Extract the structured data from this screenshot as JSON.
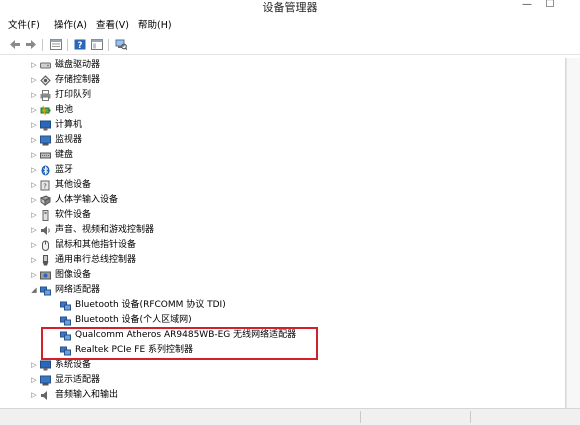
{
  "window": {
    "title": "设备管理器",
    "minimize_glyph": "—",
    "maximize_glyph": "☐"
  },
  "menu": [
    {
      "label": "文件(F)"
    },
    {
      "label": "操作(A)"
    },
    {
      "label": "查看(V)"
    },
    {
      "label": "帮助(H)"
    }
  ],
  "toolbar": {
    "buttons": [
      {
        "icon": "back-arrow-icon"
      },
      {
        "icon": "forward-arrow-icon"
      },
      {
        "icon": "properties-icon"
      },
      {
        "icon": "help-icon"
      },
      {
        "icon": "show-hide-console-tree-icon"
      },
      {
        "icon": "scan-hardware-icon"
      }
    ]
  },
  "tree": {
    "categories_before": [
      {
        "label": "磁盘驱动器",
        "icon": "disk-drive-icon",
        "expander": "▷"
      },
      {
        "label": "存储控制器",
        "icon": "storage-controller-icon",
        "expander": "▷"
      },
      {
        "label": "打印队列",
        "icon": "printer-icon",
        "expander": "▷"
      },
      {
        "label": "电池",
        "icon": "battery-icon",
        "expander": "▷"
      },
      {
        "label": "计算机",
        "icon": "computer-icon",
        "expander": "▷"
      },
      {
        "label": "监视器",
        "icon": "monitor-icon",
        "expander": "▷"
      },
      {
        "label": "键盘",
        "icon": "keyboard-icon",
        "expander": "▷"
      },
      {
        "label": "蓝牙",
        "icon": "bluetooth-icon",
        "expander": "▷"
      },
      {
        "label": "其他设备",
        "icon": "other-devices-icon",
        "expander": "▷"
      },
      {
        "label": "人体学输入设备",
        "icon": "hid-icon",
        "expander": "▷"
      },
      {
        "label": "软件设备",
        "icon": "software-device-icon",
        "expander": "▷"
      },
      {
        "label": "声音、视频和游戏控制器",
        "icon": "sound-icon",
        "expander": "▷"
      },
      {
        "label": "鼠标和其他指针设备",
        "icon": "mouse-icon",
        "expander": "▷"
      },
      {
        "label": "通用串行总线控制器",
        "icon": "usb-icon",
        "expander": "▷"
      },
      {
        "label": "图像设备",
        "icon": "imaging-device-icon",
        "expander": "▷"
      }
    ],
    "network_adapters": {
      "label": "网络适配器",
      "icon": "network-adapter-icon",
      "expander": "◢",
      "children": [
        {
          "label": "Bluetooth 设备(RFCOMM 协议 TDI)",
          "icon": "network-adapter-icon"
        },
        {
          "label": "Bluetooth 设备(个人区域网)",
          "icon": "network-adapter-icon"
        },
        {
          "label": "Qualcomm Atheros AR9485WB-EG 无线网络适配器",
          "icon": "network-adapter-icon"
        },
        {
          "label": "Realtek PCIe FE 系列控制器",
          "icon": "network-adapter-icon"
        }
      ]
    },
    "categories_after": [
      {
        "label": "系统设备",
        "icon": "system-device-icon",
        "expander": "▷"
      },
      {
        "label": "显示适配器",
        "icon": "display-adapter-icon",
        "expander": "▷"
      },
      {
        "label": "音频输入和输出",
        "icon": "audio-io-icon",
        "expander": "▷"
      }
    ]
  },
  "colors": {
    "highlight_border": "#d5202a",
    "icon_blue": "#2a67b8",
    "icon_gray": "#7a7a7a"
  }
}
